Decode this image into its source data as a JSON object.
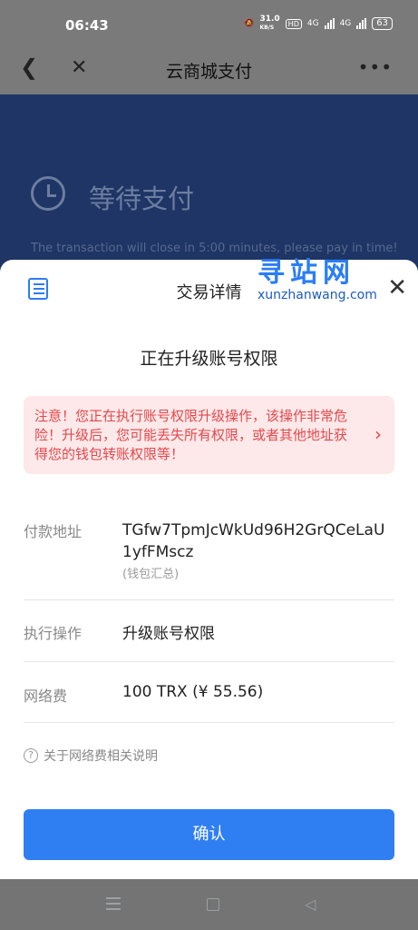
{
  "status_bar": {
    "time": "06:43",
    "net_speed_value": "31.0",
    "net_speed_unit": "KB/S",
    "hd_badge": "HD",
    "network_1": "4G",
    "network_2": "4G",
    "battery": "63"
  },
  "app_bar": {
    "title": "云商城支付",
    "more": "•••"
  },
  "page": {
    "status_title": "等待支付",
    "close_notice": "The transaction will close in 5:00  minutes, please pay in time!"
  },
  "watermark": {
    "text_cn": "寻站网",
    "text_en": "xunzhanwang.com"
  },
  "sheet": {
    "title": "交易详情",
    "operation_title": "正在升级账号权限",
    "warning": "注意！您正在执行账号权限升级操作，该操作非常危险！升级后，您可能丢失所有权限，或者其他地址获得您的钱包转账权限等！",
    "rows": {
      "address_label": "付款地址",
      "address_value": "TGfw7TpmJcWkUd96H2GrQCeLaU1yfFMscz",
      "address_note": "(钱包汇总)",
      "action_label": "执行操作",
      "action_value": "升级账号权限",
      "fee_label": "网络费",
      "fee_value": "100 TRX (¥ 55.56)"
    },
    "fee_help": "关于网络费相关说明",
    "confirm_label": "确认"
  },
  "colors": {
    "accent": "#2f7ff3",
    "warning_bg": "#fde9e9",
    "warning_text": "#e5484d",
    "dimmed_page": "#1e3565"
  }
}
